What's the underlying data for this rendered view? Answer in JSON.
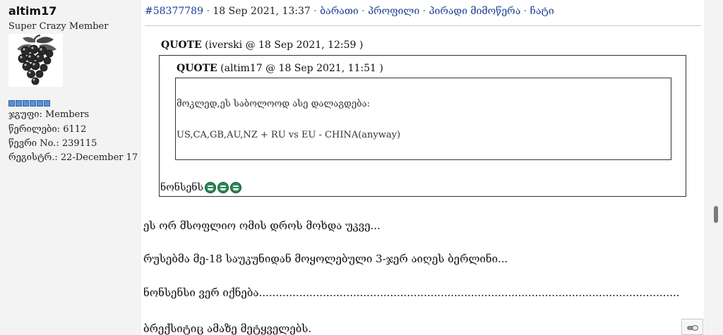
{
  "user": {
    "name": "altim17",
    "title": "Super Crazy Member",
    "rank_pips": 6,
    "group": "ჯგუფი: Members",
    "posts": "წერილები: 6112",
    "member_no": "წევრი No.: 239115",
    "registered": "რეგისტრ.: 22-December 17"
  },
  "post_header": {
    "post_id": "#58377789",
    "sep0": " · ",
    "date": "18 Sep 2021, 13:37",
    "sep1": " · ",
    "link_barati": "ბარათი",
    "sep2": " · ",
    "link_profile": "პროფილი",
    "sep3": " · ",
    "link_pm": "პირადი მიმოწერა",
    "sep4": " · ",
    "link_chat": "ჩატი"
  },
  "quote_outer": {
    "label": "QUOTE",
    "meta": " (iverski @ 18 Sep 2021, 12:59 )",
    "reply": "ნონსენს"
  },
  "quote_inner": {
    "label": "QUOTE",
    "meta": " (altim17 @ 18 Sep 2021, 11:51 )",
    "line1": "მოკლედ,ეს საბოლოოდ ასე დალაგდება:",
    "line2": "US,CA,GB,AU,NZ + RU vs EU  - CHINA(anyway)"
  },
  "body_lines": [
    "ეს ორ მსოფლიო ომის დროს მოხდა უკვე...",
    "რუსებმა მე-18 საუკუნიდან მოყოლებული 3-ჯერ აიღეს ბერლინი...",
    "ნონსენსი ვერ იქნება.............................................................................................................................",
    "ბრექსიტიც ამაზე მეტყველებს."
  ],
  "icons": {
    "avatar": "grapes-avatar",
    "smiley": "laughing-smiley-icon",
    "toggle": "toggle-switch-icon"
  },
  "colors": {
    "link": "#1a3d8f",
    "panel_bg": "#f3f3f3",
    "pip": "#5b8fd6",
    "smiley": "#2e8b57"
  }
}
